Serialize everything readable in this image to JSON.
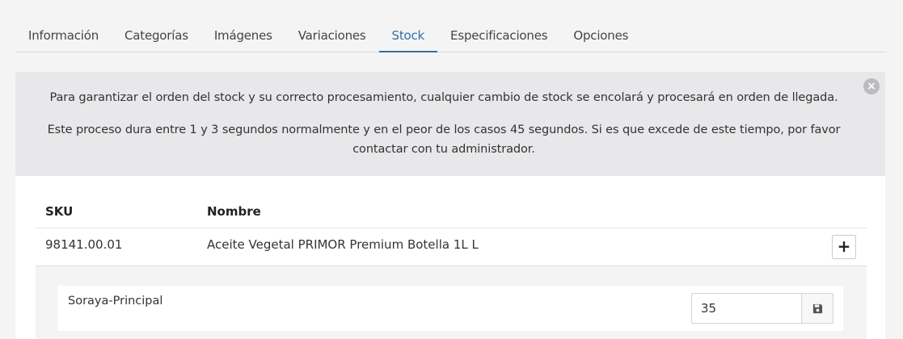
{
  "tabs": [
    {
      "label": "Información"
    },
    {
      "label": "Categorías"
    },
    {
      "label": "Imágenes"
    },
    {
      "label": "Variaciones"
    },
    {
      "label": "Stock",
      "active": true
    },
    {
      "label": "Especificaciones"
    },
    {
      "label": "Opciones"
    }
  ],
  "alert": {
    "message_1": "Para garantizar el orden del stock y su correcto procesamiento, cualquier cambio de stock se encolará y procesará en orden de llegada.",
    "message_2": "Este proceso dura entre 1 y 3 segundos normalmente y en el peor de los casos 45 segundos. Si es que excede de este tiempo, por favor contactar con tu administrador.",
    "close_icon": "×"
  },
  "table": {
    "headers": {
      "sku": "SKU",
      "name": "Nombre"
    },
    "rows": [
      {
        "sku": "98141.00.01",
        "name": "Aceite Vegetal PRIMOR Premium Botella 1L L",
        "add_icon": "+",
        "stock": [
          {
            "warehouse": "Soraya-Principal",
            "quantity": "35"
          }
        ]
      }
    ]
  },
  "colors": {
    "accent": "#2f6fa8",
    "alert_bg": "#e8e8ea"
  }
}
